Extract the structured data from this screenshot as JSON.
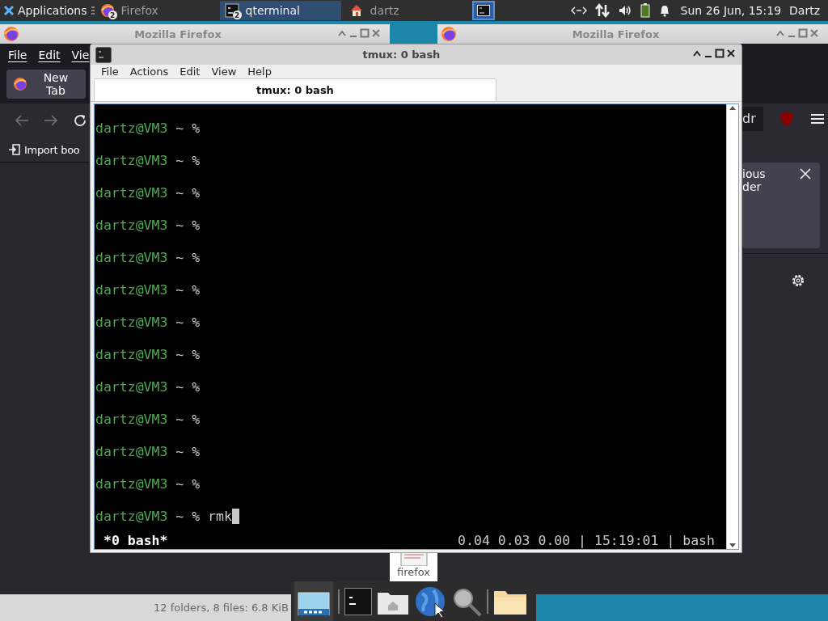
{
  "panel": {
    "menu": "Applications",
    "tasks": [
      {
        "kind": "firefox",
        "label": "Firefox",
        "badge": "2",
        "selected": false
      },
      {
        "kind": "terminal",
        "label": "qterminal",
        "badge": "2",
        "selected": true
      },
      {
        "kind": "home",
        "label": "dartz",
        "selected": false
      }
    ],
    "clock": "Sun 26 Jun, 15:19",
    "user": "Dartz"
  },
  "firefox_left": {
    "title": "Mozilla Firefox",
    "menu": [
      "File",
      "Edit",
      "Vie"
    ],
    "tab": "New Tab",
    "bookmark": "Import boo"
  },
  "firefox_right": {
    "title": "Mozilla Firefox",
    "address": "dr",
    "notice_lines": [
      "ious",
      "der"
    ]
  },
  "terminal": {
    "title": "tmux: 0 bash",
    "menu": [
      "File",
      "Actions",
      "Edit",
      "View",
      "Help"
    ],
    "tab": {
      "label": "tmux: 0 bash",
      "selected": true
    },
    "lines": [
      {
        "prompt": "dartz@VM3",
        "path": "~ %",
        "cursor": false
      },
      {
        "prompt": "dartz@VM3",
        "path": "~ %",
        "cursor": false
      },
      {
        "prompt": "dartz@VM3",
        "path": "~ %",
        "cursor": false
      },
      {
        "prompt": "dartz@VM3",
        "path": "~ %",
        "cursor": false
      },
      {
        "prompt": "dartz@VM3",
        "path": "~ %",
        "cursor": false
      },
      {
        "prompt": "dartz@VM3",
        "path": "~ %",
        "cursor": false
      },
      {
        "prompt": "dartz@VM3",
        "path": "~ %",
        "cursor": false
      },
      {
        "prompt": "dartz@VM3",
        "path": "~ %",
        "cursor": false
      },
      {
        "prompt": "dartz@VM3",
        "path": "~ %",
        "cursor": false
      },
      {
        "prompt": "dartz@VM3",
        "path": "~ %",
        "cursor": false
      },
      {
        "prompt": "dartz@VM3",
        "path": "~ %",
        "cursor": false
      },
      {
        "prompt": "dartz@VM3",
        "path": "~ %",
        "cursor": false
      },
      {
        "prompt": "dartz@VM3",
        "path": "~ %",
        "command": "rmk",
        "cursor": true
      }
    ],
    "status_left": "*0 bash*",
    "status_right": "0.04 0.03 0.00 | 15:19:01 | bash"
  },
  "file_manager": {
    "file_label": "firefox",
    "status": "12 folders, 8 files: 6.8 KiB"
  }
}
